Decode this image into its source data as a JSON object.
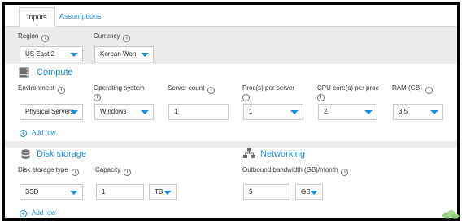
{
  "tabs": [
    {
      "label": "Inputs"
    },
    {
      "label": "Assumptions"
    }
  ],
  "region": {
    "label": "Region",
    "value": "US East 2"
  },
  "currency": {
    "label": "Currency",
    "value": "Korean Won"
  },
  "compute": {
    "title": "Compute",
    "environment": {
      "label": "Environment",
      "value": "Physical Servers"
    },
    "os": {
      "label": "Operating system",
      "value": "Windows"
    },
    "server_count": {
      "label": "Server count",
      "value": "1"
    },
    "procs": {
      "label": "Proc(s) per server",
      "value": "1"
    },
    "cores": {
      "label": "CPU core(s) per proc",
      "value": "2"
    },
    "ram": {
      "label": "RAM (GB)",
      "value": "3.5"
    },
    "add_row": "Add row"
  },
  "disk": {
    "title": "Disk storage",
    "type": {
      "label": "Disk storage type",
      "value": "SSD"
    },
    "capacity": {
      "label": "Capacity",
      "value": "1",
      "unit": "TB"
    },
    "add_row": "Add row"
  },
  "networking": {
    "title": "Networking",
    "bandwidth": {
      "label": "Outbound bandwidth (GB)/month",
      "value": "5",
      "unit": "GB"
    }
  },
  "colors": {
    "accent": "#1a8fd6",
    "band": "#ececec"
  },
  "icons": [
    "info-icon",
    "server-icon",
    "database-icon",
    "network-icon",
    "plus-circle-icon",
    "cloud-icon"
  ]
}
